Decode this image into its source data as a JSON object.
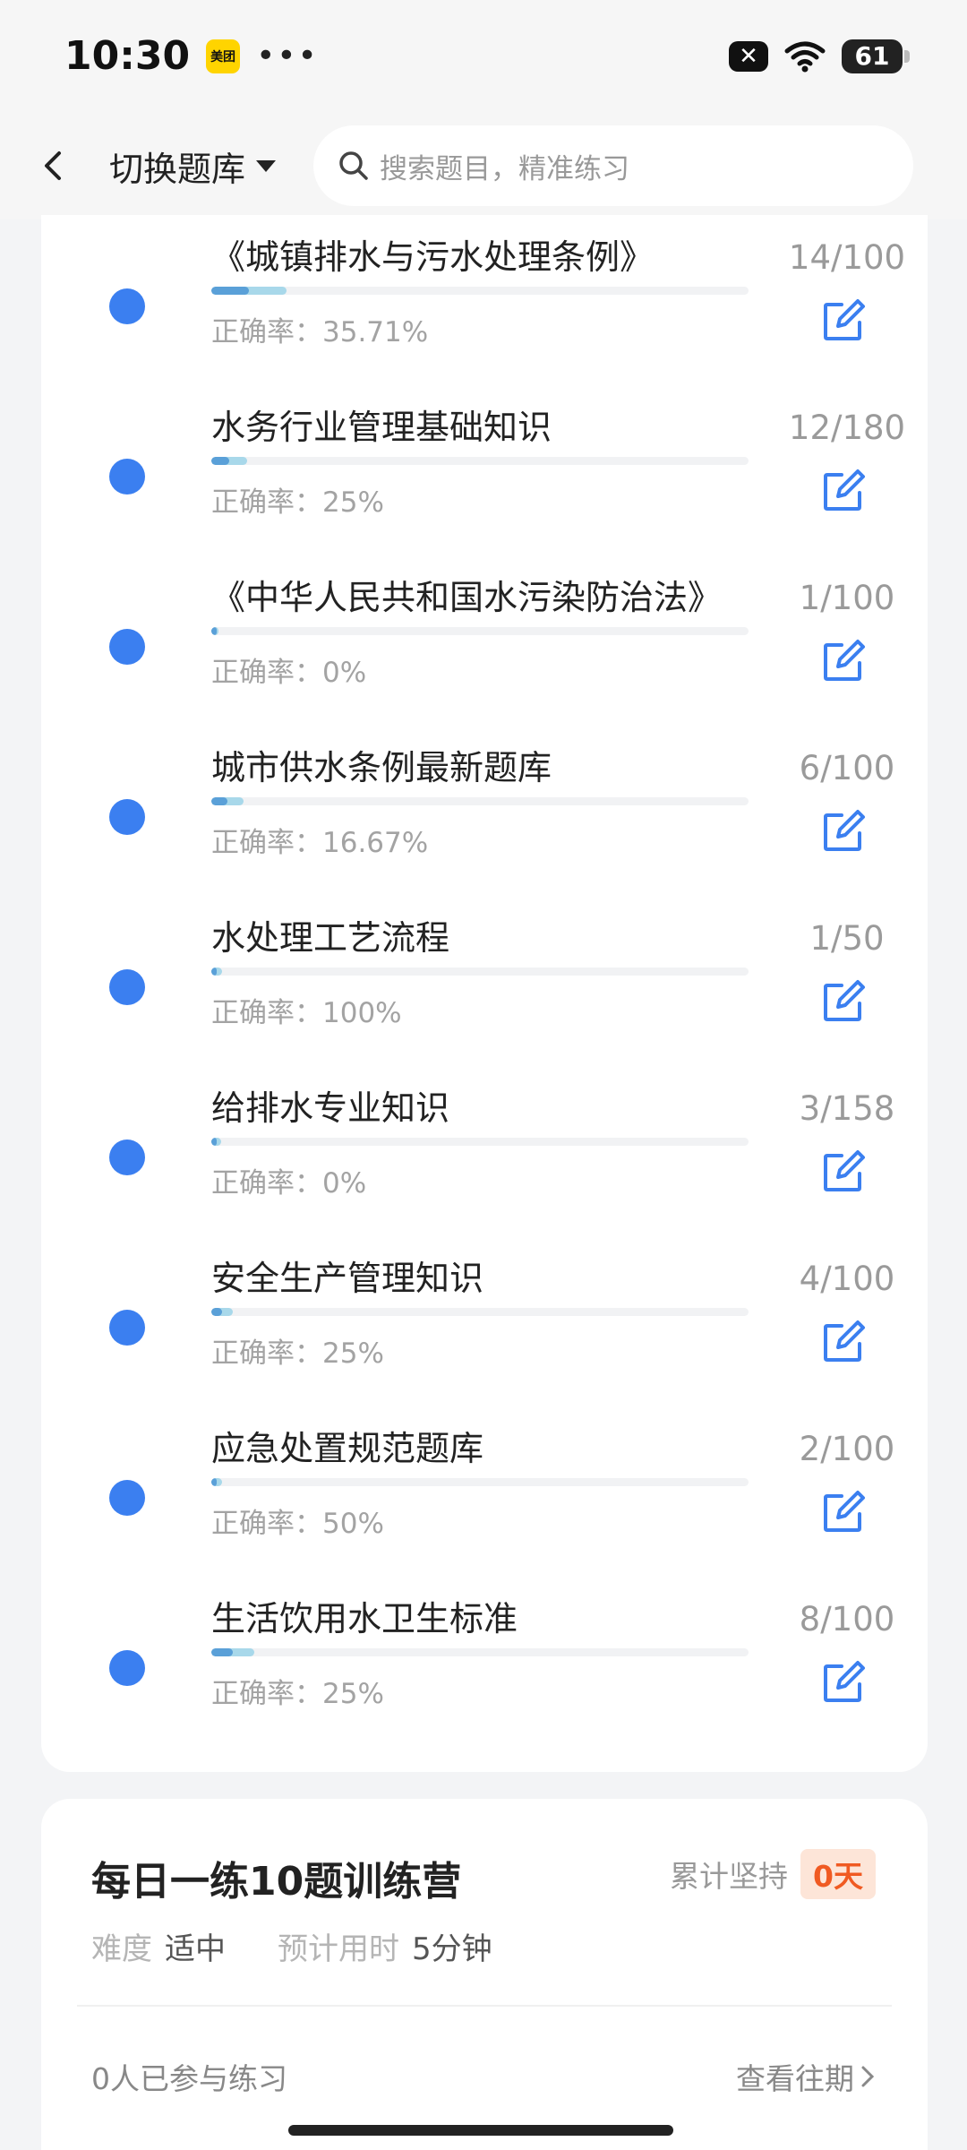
{
  "status_bar": {
    "time": "10:30",
    "app_icon": "meituan-icon",
    "app_label": "美团",
    "more": "•••",
    "battery": "61"
  },
  "header": {
    "switch_label": "切换题库",
    "search_placeholder": "搜索题目，精准练习"
  },
  "items": [
    {
      "title": "《城镇排水与污水处理条例》",
      "rate": "正确率：35.71%",
      "count": "14/100",
      "progress": 0.14
    },
    {
      "title": "水务行业管理基础知识",
      "rate": "正确率：25%",
      "count": "12/180",
      "progress": 0.0667
    },
    {
      "title": "《中华人民共和国水污染防治法》",
      "rate": "正确率：0%",
      "count": "1/100",
      "progress": 0.01
    },
    {
      "title": "城市供水条例最新题库",
      "rate": "正确率：16.67%",
      "count": "6/100",
      "progress": 0.06
    },
    {
      "title": "水处理工艺流程",
      "rate": "正确率：100%",
      "count": "1/50",
      "progress": 0.02
    },
    {
      "title": "给排水专业知识",
      "rate": "正确率：0%",
      "count": "3/158",
      "progress": 0.019
    },
    {
      "title": "安全生产管理知识",
      "rate": "正确率：25%",
      "count": "4/100",
      "progress": 0.04
    },
    {
      "title": "应急处置规范题库",
      "rate": "正确率：50%",
      "count": "2/100",
      "progress": 0.02
    },
    {
      "title": "生活饮用水卫生标准",
      "rate": "正确率：25%",
      "count": "8/100",
      "progress": 0.08
    }
  ],
  "daily": {
    "title": "每日一练10题训练营",
    "streak_label": "累计坚持",
    "streak_value": "0天",
    "difficulty_label": "难度",
    "difficulty_value": "适中",
    "time_label": "预计用时",
    "time_value": "5分钟",
    "participants": "0人已参与练习",
    "view_past": "查看往期"
  },
  "colors": {
    "accent": "#3b7ff0",
    "progress_light": "#a8d8ea",
    "progress_dark": "#5aa0d8",
    "streak_text": "#f05a22",
    "streak_bg": "#fde5d8"
  }
}
